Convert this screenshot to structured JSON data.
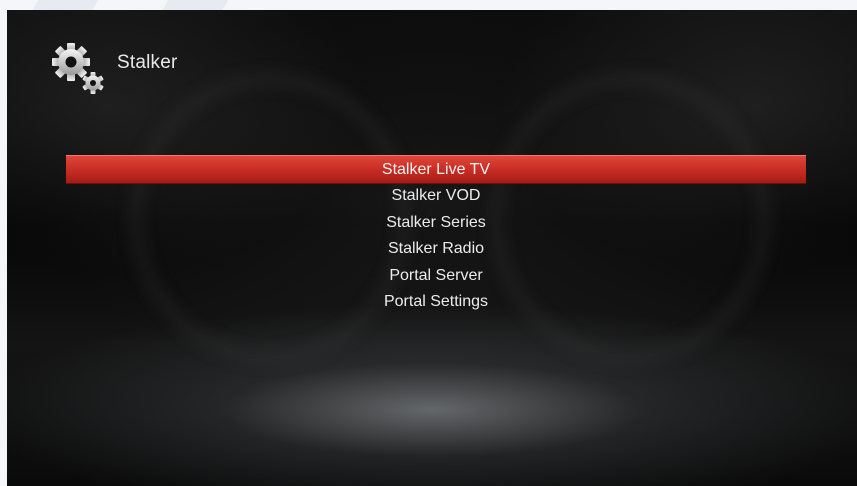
{
  "header": {
    "title": "Stalker",
    "icon": "gears-icon"
  },
  "menu": {
    "selected_index": 0,
    "items": [
      {
        "label": "Stalker Live TV"
      },
      {
        "label": "Stalker VOD"
      },
      {
        "label": "Stalker Series"
      },
      {
        "label": "Stalker Radio"
      },
      {
        "label": "Portal Server"
      },
      {
        "label": "Portal Settings"
      }
    ]
  },
  "colors": {
    "selection": "#c62b22",
    "text": "#ececec",
    "background": "#050505"
  }
}
